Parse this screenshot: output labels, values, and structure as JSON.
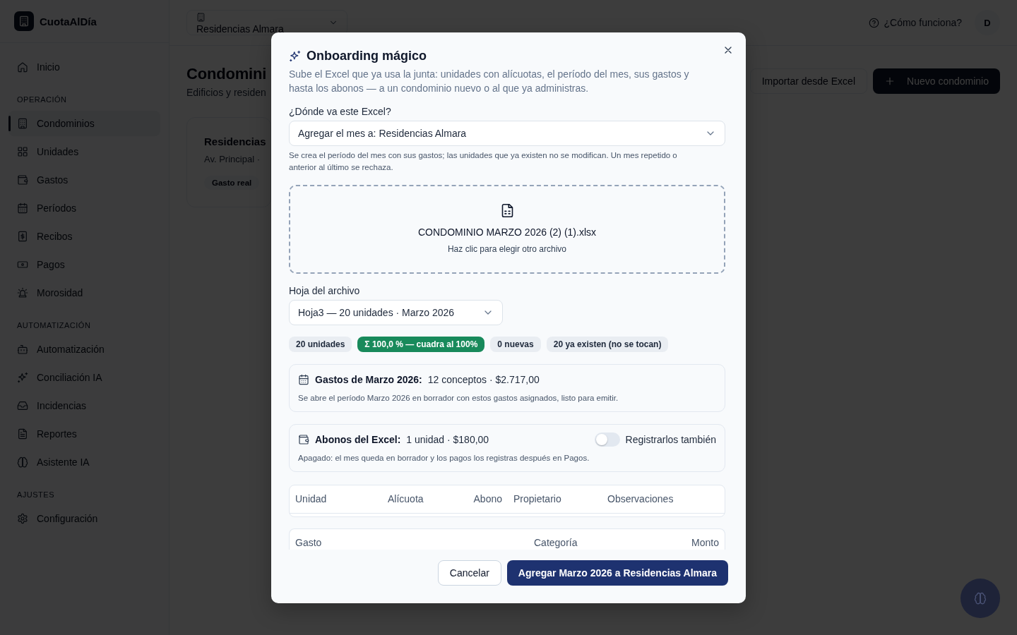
{
  "sidebar": {
    "brand": "CuotaAlDía",
    "sections": [
      {
        "items": [
          {
            "label": "Inicio",
            "selected": false
          }
        ]
      },
      {
        "title": "OPERACIÓN",
        "items": [
          {
            "label": "Condominios",
            "selected": true
          },
          {
            "label": "Unidades",
            "selected": false
          },
          {
            "label": "Gastos",
            "selected": false
          },
          {
            "label": "Períodos",
            "selected": false
          },
          {
            "label": "Recibos",
            "selected": false
          },
          {
            "label": "Pagos",
            "selected": false
          },
          {
            "label": "Morosidad",
            "selected": false
          }
        ]
      },
      {
        "title": "AUTOMATIZACIÓN",
        "items": [
          {
            "label": "Automatización",
            "selected": false
          },
          {
            "label": "Conciliación IA",
            "selected": false
          },
          {
            "label": "Incidencias",
            "selected": false
          },
          {
            "label": "Reportes",
            "selected": false
          },
          {
            "label": "Asistente IA",
            "selected": false
          }
        ]
      },
      {
        "title": "AJUSTES",
        "items": [
          {
            "label": "Configuración",
            "selected": false
          }
        ]
      }
    ]
  },
  "topbar": {
    "condo_selector": "Residencias Almara",
    "help_link": "¿Cómo funciona?",
    "avatar": "D"
  },
  "page": {
    "title": "Condomini",
    "subtitle": "Edificios y residen",
    "actions": [
      {
        "label": "Importar desde Excel",
        "kind": "secondary"
      },
      {
        "label": "Nuevo condominio",
        "kind": "primary"
      }
    ],
    "cards": [
      {
        "name": "Residencias",
        "address": "Av. Principal ·",
        "tags": [
          "Gasto real"
        ]
      }
    ]
  },
  "dialog": {
    "title": "Onboarding mágico",
    "description": "Sube el Excel que ya usa la junta: unidades con alícuotas, el período del mes, sus gastos y hasta los abonos — a un condominio nuevo o al que ya administras.",
    "destination": {
      "label": "¿Dónde va este Excel?",
      "value": "Agregar el mes a: Residencias Almara",
      "help": "Se crea el período del mes con sus gastos; las unidades que ya existen no se modifican. Un mes repetido o anterior al último se rechaza."
    },
    "file": {
      "name": "CONDOMINIO MARZO 2026 (2) (1).xlsx",
      "hint": "Haz clic para elegir otro archivo"
    },
    "sheet": {
      "label": "Hoja del archivo",
      "value": "Hoja3 — 20 unidades · Marzo 2026"
    },
    "badges": [
      {
        "text": "20 unidades",
        "kind": "neutral"
      },
      {
        "text": "Σ 100,0 % — cuadra al 100%",
        "kind": "success"
      },
      {
        "text": "0 nuevas",
        "kind": "neutral"
      },
      {
        "text": "20 ya existen (no se tocan)",
        "kind": "neutral"
      }
    ],
    "summaries": [
      {
        "title": "Gastos de Marzo 2026:",
        "detail": "12 conceptos · $2.717,00",
        "note": "Se abre el período Marzo 2026 en borrador con estos gastos asignados, listo para emitir."
      },
      {
        "title": "Abonos del Excel:",
        "detail": "1 unidad · $180,00",
        "note": "Apagado: el mes queda en borrador y los pagos los registras después en Pagos.",
        "toggle": {
          "label": "Registrarlos también",
          "on": false
        }
      }
    ],
    "units_table": {
      "columns": [
        "Unidad",
        "Alícuota",
        "Abono",
        "Propietario",
        "Observaciones"
      ]
    },
    "expenses_table": {
      "columns": [
        "Gasto",
        "Categoría",
        "Monto"
      ]
    },
    "buttons": [
      {
        "label": "Cancelar",
        "kind": "secondary"
      },
      {
        "label": "Agregar Marzo 2026 a Residencias Almara",
        "kind": "primary"
      }
    ]
  }
}
